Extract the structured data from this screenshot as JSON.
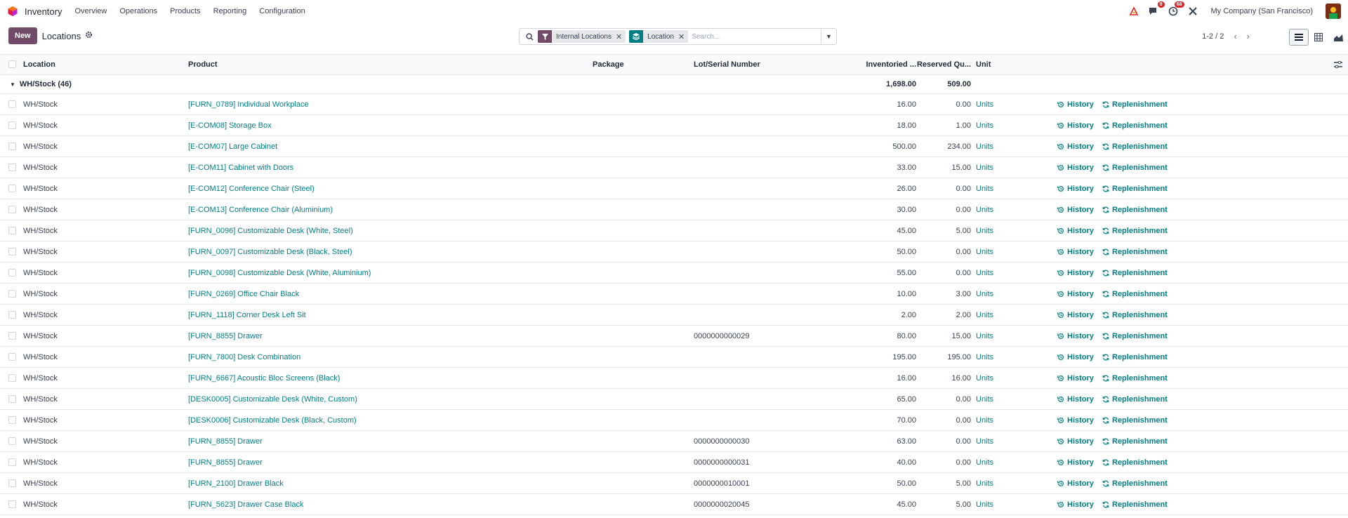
{
  "navbar": {
    "app_name": "Inventory",
    "menu": [
      "Overview",
      "Operations",
      "Products",
      "Reporting",
      "Configuration"
    ],
    "chat_badge": "9",
    "activity_badge": "68",
    "company": "My Company (San Francisco)"
  },
  "control": {
    "new_label": "New",
    "title": "Locations",
    "facets": [
      {
        "label": "Internal Locations",
        "color": "#714b67",
        "icon": "filter-icon"
      },
      {
        "label": "Location",
        "color": "#017e84",
        "icon": "layers-icon"
      }
    ],
    "search_placeholder": "Search...",
    "pager": "1-2 / 2"
  },
  "table": {
    "headers": {
      "location": "Location",
      "product": "Product",
      "package": "Package",
      "lot": "Lot/Serial Number",
      "inventoried": "Inventoried ...",
      "reserved": "Reserved Qu...",
      "unit": "Unit"
    },
    "group": {
      "label": "WH/Stock (46)",
      "inventoried": "1,698.00",
      "reserved": "509.00"
    },
    "history_label": "History",
    "replenishment_label": "Replenishment",
    "rows": [
      {
        "location": "WH/Stock",
        "product": "[FURN_0789] Individual Workplace",
        "lot": "",
        "inventoried": "16.00",
        "reserved": "0.00",
        "unit": "Units"
      },
      {
        "location": "WH/Stock",
        "product": "[E-COM08] Storage Box",
        "lot": "",
        "inventoried": "18.00",
        "reserved": "1.00",
        "unit": "Units"
      },
      {
        "location": "WH/Stock",
        "product": "[E-COM07] Large Cabinet",
        "lot": "",
        "inventoried": "500.00",
        "reserved": "234.00",
        "unit": "Units"
      },
      {
        "location": "WH/Stock",
        "product": "[E-COM11] Cabinet with Doors",
        "lot": "",
        "inventoried": "33.00",
        "reserved": "15.00",
        "unit": "Units"
      },
      {
        "location": "WH/Stock",
        "product": "[E-COM12] Conference Chair (Steel)",
        "lot": "",
        "inventoried": "26.00",
        "reserved": "0.00",
        "unit": "Units"
      },
      {
        "location": "WH/Stock",
        "product": "[E-COM13] Conference Chair (Aluminium)",
        "lot": "",
        "inventoried": "30.00",
        "reserved": "0.00",
        "unit": "Units"
      },
      {
        "location": "WH/Stock",
        "product": "[FURN_0096] Customizable Desk (White, Steel)",
        "lot": "",
        "inventoried": "45.00",
        "reserved": "5.00",
        "unit": "Units"
      },
      {
        "location": "WH/Stock",
        "product": "[FURN_0097] Customizable Desk (Black, Steel)",
        "lot": "",
        "inventoried": "50.00",
        "reserved": "0.00",
        "unit": "Units"
      },
      {
        "location": "WH/Stock",
        "product": "[FURN_0098] Customizable Desk (White, Aluminium)",
        "lot": "",
        "inventoried": "55.00",
        "reserved": "0.00",
        "unit": "Units"
      },
      {
        "location": "WH/Stock",
        "product": "[FURN_0269] Office Chair Black",
        "lot": "",
        "inventoried": "10.00",
        "reserved": "3.00",
        "unit": "Units"
      },
      {
        "location": "WH/Stock",
        "product": "[FURN_1118] Corner Desk Left Sit",
        "lot": "",
        "inventoried": "2.00",
        "reserved": "2.00",
        "unit": "Units"
      },
      {
        "location": "WH/Stock",
        "product": "[FURN_8855] Drawer",
        "lot": "0000000000029",
        "inventoried": "80.00",
        "reserved": "15.00",
        "unit": "Units"
      },
      {
        "location": "WH/Stock",
        "product": "[FURN_7800] Desk Combination",
        "lot": "",
        "inventoried": "195.00",
        "reserved": "195.00",
        "unit": "Units"
      },
      {
        "location": "WH/Stock",
        "product": "[FURN_6667] Acoustic Bloc Screens (Black)",
        "lot": "",
        "inventoried": "16.00",
        "reserved": "16.00",
        "unit": "Units"
      },
      {
        "location": "WH/Stock",
        "product": "[DESK0005] Customizable Desk (White, Custom)",
        "lot": "",
        "inventoried": "65.00",
        "reserved": "0.00",
        "unit": "Units"
      },
      {
        "location": "WH/Stock",
        "product": "[DESK0006] Customizable Desk (Black, Custom)",
        "lot": "",
        "inventoried": "70.00",
        "reserved": "0.00",
        "unit": "Units"
      },
      {
        "location": "WH/Stock",
        "product": "[FURN_8855] Drawer",
        "lot": "0000000000030",
        "inventoried": "63.00",
        "reserved": "0.00",
        "unit": "Units"
      },
      {
        "location": "WH/Stock",
        "product": "[FURN_8855] Drawer",
        "lot": "0000000000031",
        "inventoried": "40.00",
        "reserved": "0.00",
        "unit": "Units"
      },
      {
        "location": "WH/Stock",
        "product": "[FURN_2100] Drawer Black",
        "lot": "0000000010001",
        "inventoried": "50.00",
        "reserved": "5.00",
        "unit": "Units"
      },
      {
        "location": "WH/Stock",
        "product": "[FURN_5623] Drawer Case Black",
        "lot": "0000000020045",
        "inventoried": "45.00",
        "reserved": "5.00",
        "unit": "Units"
      }
    ]
  }
}
